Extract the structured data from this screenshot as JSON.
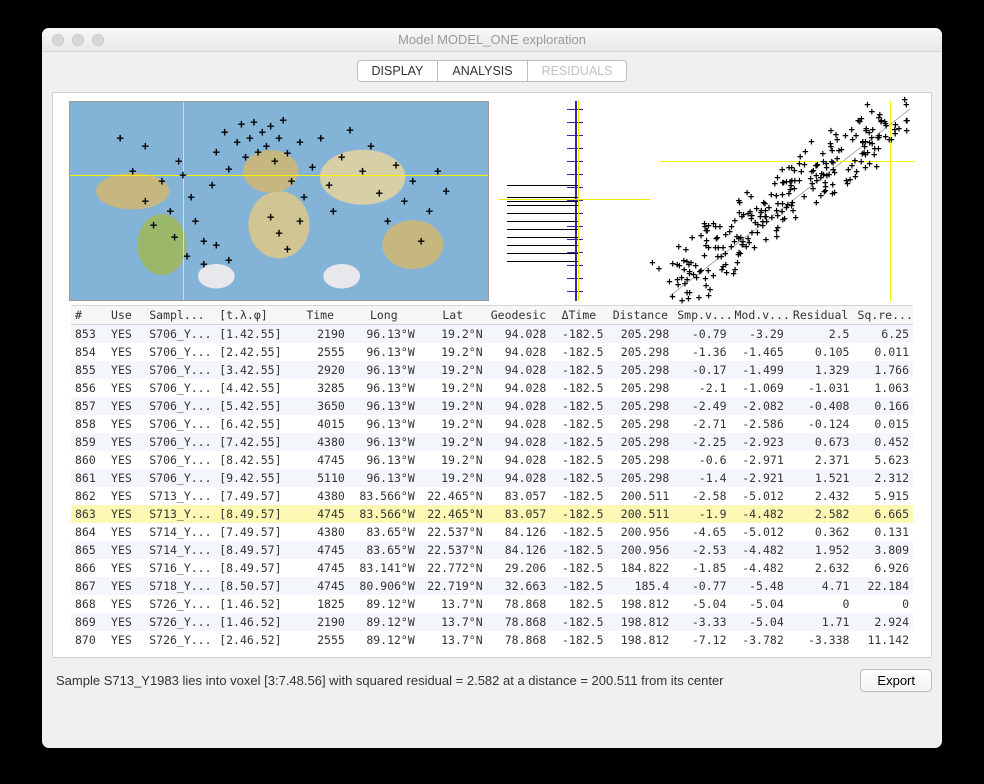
{
  "window": {
    "title": "Model MODEL_ONE exploration"
  },
  "tabs": {
    "display": "DISPLAY",
    "analysis": "ANALYSIS",
    "residuals": "RESIDUALS",
    "selected": "RESIDUALS"
  },
  "table": {
    "headers": [
      "#",
      "Use",
      "Sampl...",
      "[t.λ.φ]",
      "Time",
      "Long",
      "Lat",
      "Geodesic",
      "ΔTime",
      "Distance",
      "Smp.v...",
      "Mod.v...",
      "Residual",
      "Sq.re..."
    ],
    "rows": [
      {
        "idx": "853",
        "use": "YES",
        "sampl": "S706_Y...",
        "voxel": "[1.42.55]",
        "time": "2190",
        "long": "96.13°W",
        "lat": "19.2°N",
        "geo": "94.028",
        "dt": "-182.5",
        "dist": "205.298",
        "smp": "-0.79",
        "mod": "-3.29",
        "res": "2.5",
        "sq": "6.25"
      },
      {
        "idx": "854",
        "use": "YES",
        "sampl": "S706_Y...",
        "voxel": "[2.42.55]",
        "time": "2555",
        "long": "96.13°W",
        "lat": "19.2°N",
        "geo": "94.028",
        "dt": "-182.5",
        "dist": "205.298",
        "smp": "-1.36",
        "mod": "-1.465",
        "res": "0.105",
        "sq": "0.011"
      },
      {
        "idx": "855",
        "use": "YES",
        "sampl": "S706_Y...",
        "voxel": "[3.42.55]",
        "time": "2920",
        "long": "96.13°W",
        "lat": "19.2°N",
        "geo": "94.028",
        "dt": "-182.5",
        "dist": "205.298",
        "smp": "-0.17",
        "mod": "-1.499",
        "res": "1.329",
        "sq": "1.766"
      },
      {
        "idx": "856",
        "use": "YES",
        "sampl": "S706_Y...",
        "voxel": "[4.42.55]",
        "time": "3285",
        "long": "96.13°W",
        "lat": "19.2°N",
        "geo": "94.028",
        "dt": "-182.5",
        "dist": "205.298",
        "smp": "-2.1",
        "mod": "-1.069",
        "res": "-1.031",
        "sq": "1.063"
      },
      {
        "idx": "857",
        "use": "YES",
        "sampl": "S706_Y...",
        "voxel": "[5.42.55]",
        "time": "3650",
        "long": "96.13°W",
        "lat": "19.2°N",
        "geo": "94.028",
        "dt": "-182.5",
        "dist": "205.298",
        "smp": "-2.49",
        "mod": "-2.082",
        "res": "-0.408",
        "sq": "0.166"
      },
      {
        "idx": "858",
        "use": "YES",
        "sampl": "S706_Y...",
        "voxel": "[6.42.55]",
        "time": "4015",
        "long": "96.13°W",
        "lat": "19.2°N",
        "geo": "94.028",
        "dt": "-182.5",
        "dist": "205.298",
        "smp": "-2.71",
        "mod": "-2.586",
        "res": "-0.124",
        "sq": "0.015"
      },
      {
        "idx": "859",
        "use": "YES",
        "sampl": "S706_Y...",
        "voxel": "[7.42.55]",
        "time": "4380",
        "long": "96.13°W",
        "lat": "19.2°N",
        "geo": "94.028",
        "dt": "-182.5",
        "dist": "205.298",
        "smp": "-2.25",
        "mod": "-2.923",
        "res": "0.673",
        "sq": "0.452"
      },
      {
        "idx": "860",
        "use": "YES",
        "sampl": "S706_Y...",
        "voxel": "[8.42.55]",
        "time": "4745",
        "long": "96.13°W",
        "lat": "19.2°N",
        "geo": "94.028",
        "dt": "-182.5",
        "dist": "205.298",
        "smp": "-0.6",
        "mod": "-2.971",
        "res": "2.371",
        "sq": "5.623"
      },
      {
        "idx": "861",
        "use": "YES",
        "sampl": "S706_Y...",
        "voxel": "[9.42.55]",
        "time": "5110",
        "long": "96.13°W",
        "lat": "19.2°N",
        "geo": "94.028",
        "dt": "-182.5",
        "dist": "205.298",
        "smp": "-1.4",
        "mod": "-2.921",
        "res": "1.521",
        "sq": "2.312"
      },
      {
        "idx": "862",
        "use": "YES",
        "sampl": "S713_Y...",
        "voxel": "[7.49.57]",
        "time": "4380",
        "long": "83.566°W",
        "lat": "22.465°N",
        "geo": "83.057",
        "dt": "-182.5",
        "dist": "200.511",
        "smp": "-2.58",
        "mod": "-5.012",
        "res": "2.432",
        "sq": "5.915"
      },
      {
        "idx": "863",
        "use": "YES",
        "sampl": "S713_Y...",
        "voxel": "[8.49.57]",
        "time": "4745",
        "long": "83.566°W",
        "lat": "22.465°N",
        "geo": "83.057",
        "dt": "-182.5",
        "dist": "200.511",
        "smp": "-1.9",
        "mod": "-4.482",
        "res": "2.582",
        "sq": "6.665",
        "hl": true
      },
      {
        "idx": "864",
        "use": "YES",
        "sampl": "S714_Y...",
        "voxel": "[7.49.57]",
        "time": "4380",
        "long": "83.65°W",
        "lat": "22.537°N",
        "geo": "84.126",
        "dt": "-182.5",
        "dist": "200.956",
        "smp": "-4.65",
        "mod": "-5.012",
        "res": "0.362",
        "sq": "0.131"
      },
      {
        "idx": "865",
        "use": "YES",
        "sampl": "S714_Y...",
        "voxel": "[8.49.57]",
        "time": "4745",
        "long": "83.65°W",
        "lat": "22.537°N",
        "geo": "84.126",
        "dt": "-182.5",
        "dist": "200.956",
        "smp": "-2.53",
        "mod": "-4.482",
        "res": "1.952",
        "sq": "3.809"
      },
      {
        "idx": "866",
        "use": "YES",
        "sampl": "S716_Y...",
        "voxel": "[8.49.57]",
        "time": "4745",
        "long": "83.141°W",
        "lat": "22.772°N",
        "geo": "29.206",
        "dt": "-182.5",
        "dist": "184.822",
        "smp": "-1.85",
        "mod": "-4.482",
        "res": "2.632",
        "sq": "6.926"
      },
      {
        "idx": "867",
        "use": "YES",
        "sampl": "S718_Y...",
        "voxel": "[8.50.57]",
        "time": "4745",
        "long": "80.906°W",
        "lat": "22.719°N",
        "geo": "32.663",
        "dt": "-182.5",
        "dist": "185.4",
        "smp": "-0.77",
        "mod": "-5.48",
        "res": "4.71",
        "sq": "22.184"
      },
      {
        "idx": "868",
        "use": "YES",
        "sampl": "S726_Y...",
        "voxel": "[1.46.52]",
        "time": "1825",
        "long": "89.12°W",
        "lat": "13.7°N",
        "geo": "78.868",
        "dt": "182.5",
        "dist": "198.812",
        "smp": "-5.04",
        "mod": "-5.04",
        "res": "0",
        "sq": "0"
      },
      {
        "idx": "869",
        "use": "YES",
        "sampl": "S726_Y...",
        "voxel": "[1.46.52]",
        "time": "2190",
        "long": "89.12°W",
        "lat": "13.7°N",
        "geo": "78.868",
        "dt": "-182.5",
        "dist": "198.812",
        "smp": "-3.33",
        "mod": "-5.04",
        "res": "1.71",
        "sq": "2.924"
      },
      {
        "idx": "870",
        "use": "YES",
        "sampl": "S726_Y...",
        "voxel": "[2.46.52]",
        "time": "2555",
        "long": "89.12°W",
        "lat": "13.7°N",
        "geo": "78.868",
        "dt": "-182.5",
        "dist": "198.812",
        "smp": "-7.12",
        "mod": "-3.782",
        "res": "-3.338",
        "sq": "11.142"
      }
    ]
  },
  "status": "Sample S713_Y1983 lies into voxel [3:7.48.56] with squared residual = 2.582 at a distance = 200.511 from its center",
  "export_label": "Export",
  "chart_data": [
    {
      "type": "scatter",
      "role": "world-map-samples",
      "crosshair": {
        "lat_pct": 37,
        "lon_pct": 27
      },
      "note": "sample points plotted on equirectangular world map; crosshair marks selected sample at approx 83.566°W, 22.465°N"
    },
    {
      "type": "other",
      "role": "residual-rug",
      "axis": "vertical blue axis with horizontal ticks; black horizontal segments on left half; yellow crosshair near middle",
      "ticks": 15,
      "segments": 11
    },
    {
      "type": "scatter",
      "role": "sample-vs-model",
      "xlabel": "",
      "ylabel": "",
      "diagonal": true,
      "crosshair": {
        "x_pct": 90,
        "y_pct": 30
      },
      "note": "dense point cloud roughly along y=x diagonal; yellow crosshair upper-right"
    }
  ]
}
